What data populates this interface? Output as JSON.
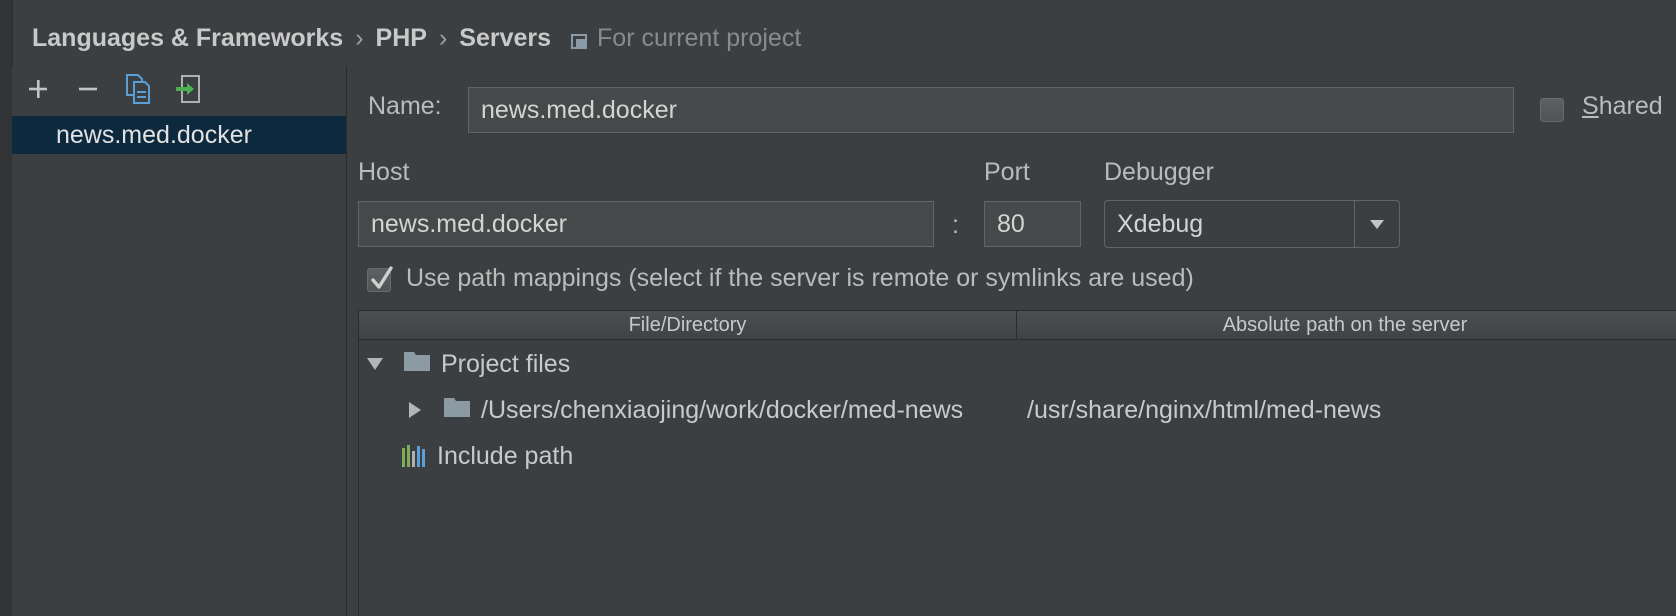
{
  "breadcrumb": {
    "items": [
      "Languages & Frameworks",
      "PHP",
      "Servers"
    ],
    "separator": "›",
    "scope": "For current project"
  },
  "toolbar": {
    "add_icon": "plus-icon",
    "remove_icon": "minus-icon",
    "copy_icon": "copy-icon",
    "import_icon": "import-icon"
  },
  "servers": {
    "items": [
      {
        "label": "news.med.docker",
        "selected": true
      }
    ]
  },
  "form": {
    "name_label": "Name:",
    "name_value": "news.med.docker",
    "shared_label": "Shared",
    "shared_mnemonic": "S",
    "shared_rest": "hared",
    "shared_checked": false,
    "host_label": "Host",
    "host_value": "news.med.docker",
    "colon": ":",
    "port_label": "Port",
    "port_value": "80",
    "debugger_label": "Debugger",
    "debugger_value": "Xdebug",
    "path_mappings_label": "Use path mappings (select if the server is remote or symlinks are used)",
    "path_mappings_checked": true
  },
  "mappings": {
    "columns": [
      "File/Directory",
      "Absolute path on the server"
    ],
    "rows": [
      {
        "level": 0,
        "expanded": true,
        "icon": "folder-icon",
        "label": "Project files",
        "server_path": ""
      },
      {
        "level": 1,
        "expanded": false,
        "icon": "folder-icon",
        "label": "/Users/chenxiaojing/work/docker/med-news",
        "server_path": "/usr/share/nginx/html/med-news"
      },
      {
        "level": 0,
        "expanded": null,
        "icon": "library-icon",
        "label": "Include path",
        "server_path": ""
      }
    ]
  },
  "colors": {
    "background": "#3c3f41",
    "selection": "#0d293e",
    "field": "#45494a",
    "folder": "#8b9aa3",
    "import_green": "#4caf50",
    "copy_blue": "#5c9fd6"
  }
}
